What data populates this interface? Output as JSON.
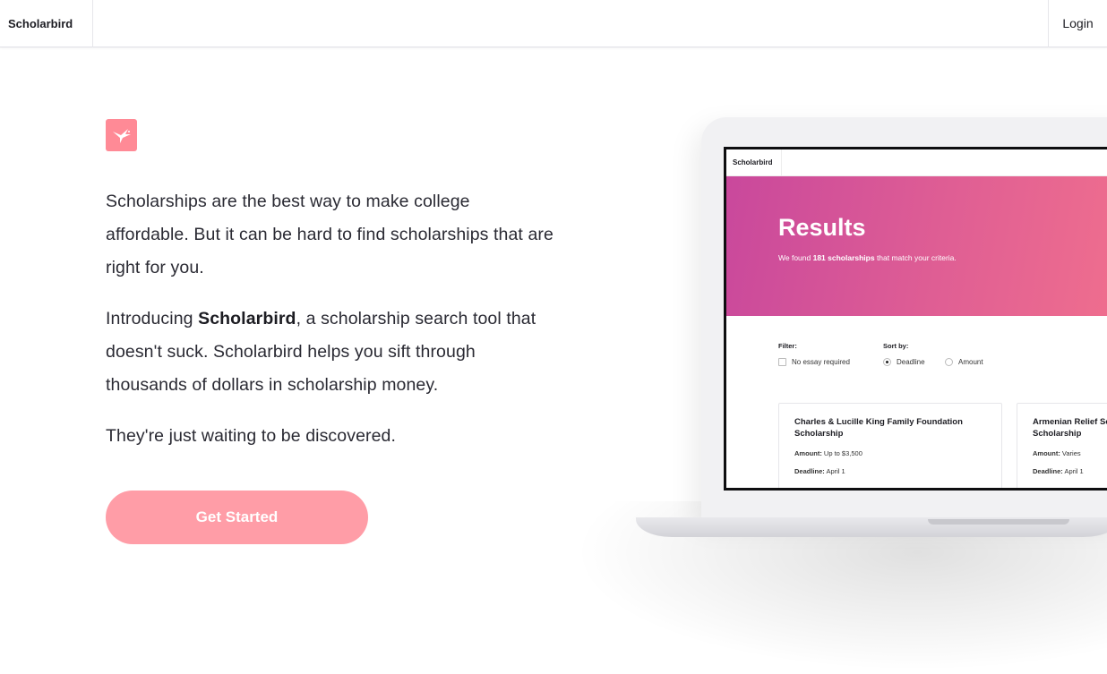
{
  "nav": {
    "brand": "Scholarbird",
    "login": "Login"
  },
  "hero": {
    "logo_icon": "bird-icon",
    "paragraph_1": "Scholarships are the best way to make college affordable. But it can be hard to find scholarships that are right for you.",
    "paragraph_2_before": "Introducing ",
    "paragraph_2_bold": "Scholarbird",
    "paragraph_2_after": ", a scholarship search tool that doesn't suck. Scholarbird helps you sift through thousands of dollars in scholarship money.",
    "paragraph_3": "They're just waiting to be discovered.",
    "cta_label": "Get Started"
  },
  "mockup": {
    "brand": "Scholarbird",
    "title": "Results",
    "subtitle_before": "We found ",
    "subtitle_bold": "181 scholarships",
    "subtitle_after": " that match your criteria.",
    "filter_label": "Filter:",
    "filter_option": "No essay required",
    "sort_label": "Sort by:",
    "sort_options": [
      "Deadline",
      "Amount"
    ],
    "cards": [
      {
        "title": "Charles & Lucille King Family Foundation Scholarship",
        "amount_label": "Amount:",
        "amount_value": "Up to $3,500",
        "deadline_label": "Deadline:",
        "deadline_value": "April 1"
      },
      {
        "title": "Armenian Relief Society Scholarship",
        "amount_label": "Amount:",
        "amount_value": "Varies",
        "deadline_label": "Deadline:",
        "deadline_value": "April 1"
      }
    ]
  },
  "colors": {
    "accent": "#ff9da7",
    "logo_bg": "#ff8a96",
    "hero_gradient_start": "#c9489c",
    "hero_gradient_end": "#ef6e8e"
  }
}
